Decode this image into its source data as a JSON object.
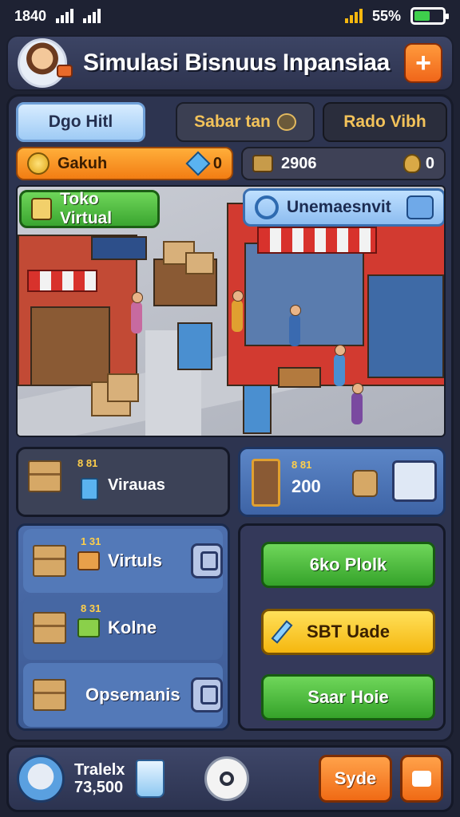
{
  "status": {
    "time": "1840",
    "battery_text": "55%",
    "battery_level": 0.55,
    "colors": {
      "battery_fill": "#3ecf4c"
    }
  },
  "header": {
    "title": "Simulasi Bisnuus Inpansiaa",
    "plus_label": "+",
    "icons": [
      "avatar",
      "plus-icon"
    ]
  },
  "tabs": [
    {
      "label": "Dgo Hitl"
    },
    {
      "label": "Sabar tan"
    },
    {
      "label": "Rado Vibh"
    }
  ],
  "resources": {
    "left_label": "Gakuh",
    "left_value": "0",
    "right_value": "2906",
    "right_small": "0"
  },
  "scene": {
    "left_button": "Toko Virtual",
    "right_button": "Unemaesnvit",
    "icons": [
      "store-icon",
      "magnifier-icon",
      "music-icon"
    ]
  },
  "cards": {
    "top_left": {
      "small": "8 81",
      "label": "Virauas"
    },
    "top_right": {
      "small": "8 81",
      "value": "200"
    },
    "list": [
      {
        "small": "1 31",
        "label": "Virtuls"
      },
      {
        "small": "8 31",
        "label": "Kolne"
      },
      {
        "label": "Opsemanis"
      }
    ]
  },
  "actions": [
    {
      "label": "6ko Plolk",
      "color": "#3aa530"
    },
    {
      "label": "SBT Uade",
      "color": "#f5b70f"
    },
    {
      "label": "Saar Hoie",
      "color": "#3aa530"
    }
  ],
  "bottom": {
    "name": "Tralelx",
    "value": "73,500",
    "right_button": "Syde"
  }
}
